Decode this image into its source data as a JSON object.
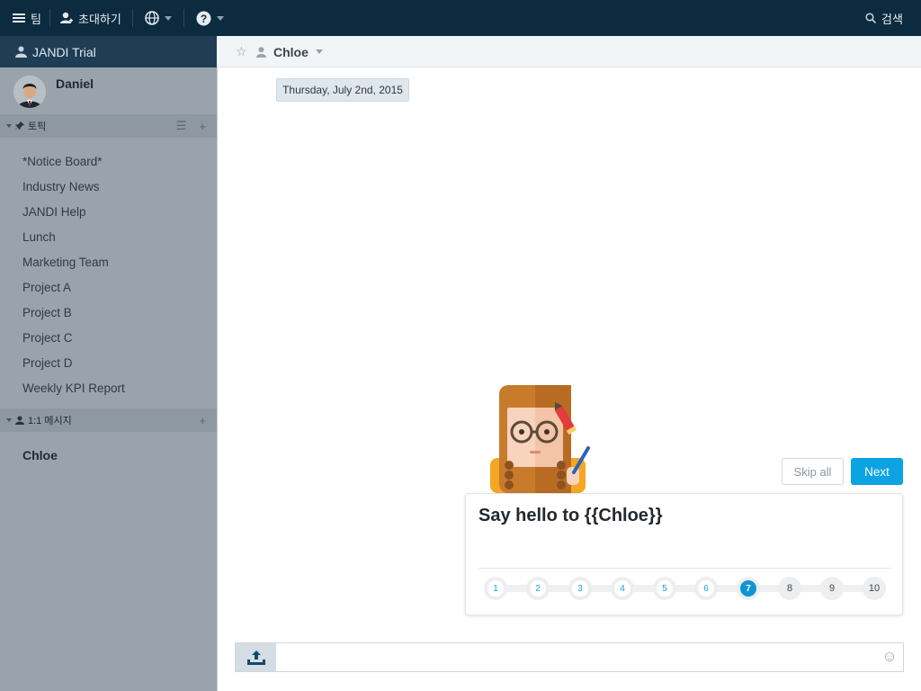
{
  "topbar": {
    "team_label": "팀",
    "invite_label": "초대하기",
    "search_label": "검색"
  },
  "sidebar": {
    "team_name": "JANDI Trial",
    "user_name": "Daniel",
    "topics_label": "토픽",
    "topics": [
      "*Notice Board*",
      "Industry News",
      "JANDI Help",
      "Lunch",
      "Marketing Team",
      "Project A",
      "Project B",
      "Project C",
      "Project D",
      "Weekly KPI Report"
    ],
    "dm_label": "1:1 메시지",
    "dm_items": [
      "Chloe"
    ]
  },
  "main": {
    "chat_name": "Chloe",
    "date_divider": "Thursday, July 2nd, 2015"
  },
  "tutorial": {
    "skip_label": "Skip all",
    "next_label": "Next",
    "title": "Say hello to {{Chloe}}",
    "steps": [
      "1",
      "2",
      "3",
      "4",
      "5",
      "6",
      "7",
      "8",
      "9",
      "10"
    ],
    "current_step": 7
  },
  "colors": {
    "topbar_bg": "#0c2b3f",
    "sidebar_bg": "#9aa3ab",
    "accent": "#0ba3e2"
  }
}
